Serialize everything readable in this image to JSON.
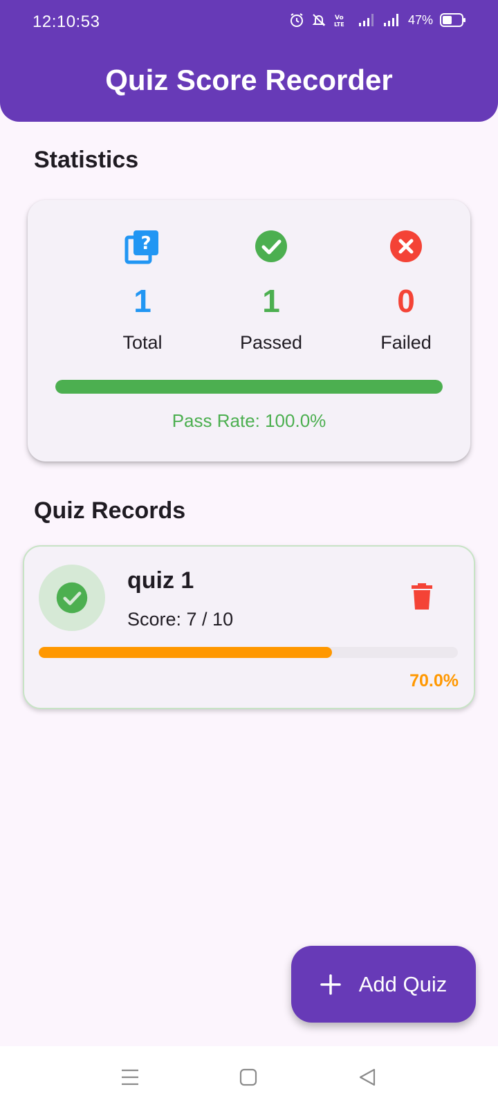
{
  "status_bar": {
    "time": "12:10:53",
    "battery": "47%",
    "icons": [
      "alarm-icon",
      "bell-off-icon",
      "volte-icon",
      "signal-icon",
      "signal-icon",
      "battery-icon"
    ]
  },
  "app_bar": {
    "title": "Quiz Score Recorder"
  },
  "statistics": {
    "title": "Statistics",
    "total": {
      "value": "1",
      "label": "Total",
      "icon": "quiz-icon",
      "color": "#2196f3"
    },
    "passed": {
      "value": "1",
      "label": "Passed",
      "icon": "check-circle-icon",
      "color": "#4caf50"
    },
    "failed": {
      "value": "0",
      "label": "Failed",
      "icon": "cancel-icon",
      "color": "#f44336"
    },
    "pass_rate_fraction": 1.0,
    "pass_rate_text": "Pass Rate: 100.0%",
    "accent_color": "#4caf50"
  },
  "records": {
    "title": "Quiz Records",
    "items": [
      {
        "name": "quiz 1",
        "score_text": "Score: 7 / 10",
        "percent_text": "70.0%",
        "fraction": 0.7,
        "status_icon": "check-circle-icon",
        "progress_color": "#ff9800",
        "delete_icon": "trash-icon"
      }
    ]
  },
  "fab": {
    "label": "Add Quiz",
    "icon": "plus-icon"
  },
  "colors": {
    "primary": "#673ab7",
    "background": "#fcf5fd"
  },
  "nav_bar": {
    "icons": [
      "menu-icon",
      "home-square-icon",
      "back-triangle-icon"
    ]
  }
}
